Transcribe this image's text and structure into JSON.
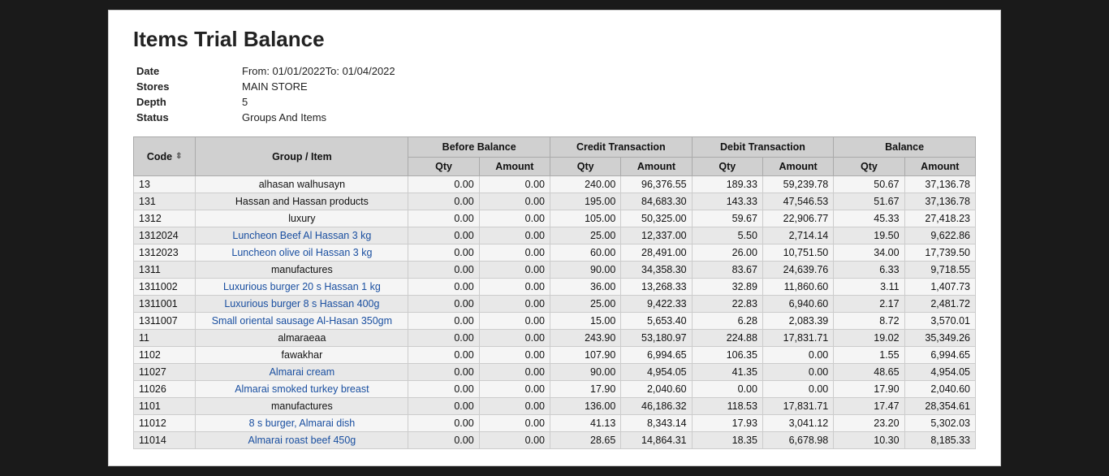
{
  "title": "Items Trial Balance",
  "meta": {
    "date_label": "Date",
    "date_value": "From: 01/01/2022To: 01/04/2022",
    "stores_label": "Stores",
    "stores_value": "MAIN STORE",
    "depth_label": "Depth",
    "depth_value": "5",
    "status_label": "Status",
    "status_value": "Groups And Items"
  },
  "table": {
    "headers": {
      "code": "Code",
      "group_item": "Group / Item",
      "before_balance": "Before Balance",
      "credit_transaction": "Credit Transaction",
      "debit_transaction": "Debit Transaction",
      "balance": "Balance"
    },
    "sub_headers": [
      "Qty",
      "Amount",
      "Qty",
      "Amount",
      "Qty",
      "Amount",
      "Qty",
      "Amount"
    ],
    "rows": [
      {
        "code": "13",
        "item": "alhasan walhusayn",
        "link": false,
        "bb_qty": "0.00",
        "bb_amt": "0.00",
        "ct_qty": "240.00",
        "ct_amt": "96,376.55",
        "dt_qty": "189.33",
        "dt_amt": "59,239.78",
        "bal_qty": "50.67",
        "bal_amt": "37,136.78"
      },
      {
        "code": "131",
        "item": "Hassan and Hassan products",
        "link": false,
        "bb_qty": "0.00",
        "bb_amt": "0.00",
        "ct_qty": "195.00",
        "ct_amt": "84,683.30",
        "dt_qty": "143.33",
        "dt_amt": "47,546.53",
        "bal_qty": "51.67",
        "bal_amt": "37,136.78"
      },
      {
        "code": "1312",
        "item": "luxury",
        "link": false,
        "bb_qty": "0.00",
        "bb_amt": "0.00",
        "ct_qty": "105.00",
        "ct_amt": "50,325.00",
        "dt_qty": "59.67",
        "dt_amt": "22,906.77",
        "bal_qty": "45.33",
        "bal_amt": "27,418.23"
      },
      {
        "code": "1312024",
        "item": "Luncheon Beef Al Hassan 3 kg",
        "link": true,
        "bb_qty": "0.00",
        "bb_amt": "0.00",
        "ct_qty": "25.00",
        "ct_amt": "12,337.00",
        "dt_qty": "5.50",
        "dt_amt": "2,714.14",
        "bal_qty": "19.50",
        "bal_amt": "9,622.86"
      },
      {
        "code": "1312023",
        "item": "Luncheon olive oil Hassan 3 kg",
        "link": true,
        "bb_qty": "0.00",
        "bb_amt": "0.00",
        "ct_qty": "60.00",
        "ct_amt": "28,491.00",
        "dt_qty": "26.00",
        "dt_amt": "10,751.50",
        "bal_qty": "34.00",
        "bal_amt": "17,739.50"
      },
      {
        "code": "1311",
        "item": "manufactures",
        "link": false,
        "bb_qty": "0.00",
        "bb_amt": "0.00",
        "ct_qty": "90.00",
        "ct_amt": "34,358.30",
        "dt_qty": "83.67",
        "dt_amt": "24,639.76",
        "bal_qty": "6.33",
        "bal_amt": "9,718.55"
      },
      {
        "code": "1311002",
        "item": "Luxurious burger 20 s Hassan 1 kg",
        "link": true,
        "bb_qty": "0.00",
        "bb_amt": "0.00",
        "ct_qty": "36.00",
        "ct_amt": "13,268.33",
        "dt_qty": "32.89",
        "dt_amt": "11,860.60",
        "bal_qty": "3.11",
        "bal_amt": "1,407.73"
      },
      {
        "code": "1311001",
        "item": "Luxurious burger 8 s Hassan 400g",
        "link": true,
        "bb_qty": "0.00",
        "bb_amt": "0.00",
        "ct_qty": "25.00",
        "ct_amt": "9,422.33",
        "dt_qty": "22.83",
        "dt_amt": "6,940.60",
        "bal_qty": "2.17",
        "bal_amt": "2,481.72"
      },
      {
        "code": "1311007",
        "item": "Small oriental sausage Al-Hasan 350gm",
        "link": true,
        "bb_qty": "0.00",
        "bb_amt": "0.00",
        "ct_qty": "15.00",
        "ct_amt": "5,653.40",
        "dt_qty": "6.28",
        "dt_amt": "2,083.39",
        "bal_qty": "8.72",
        "bal_amt": "3,570.01"
      },
      {
        "code": "11",
        "item": "almaraeaa",
        "link": false,
        "bb_qty": "0.00",
        "bb_amt": "0.00",
        "ct_qty": "243.90",
        "ct_amt": "53,180.97",
        "dt_qty": "224.88",
        "dt_amt": "17,831.71",
        "bal_qty": "19.02",
        "bal_amt": "35,349.26"
      },
      {
        "code": "1102",
        "item": "fawakhar",
        "link": false,
        "bb_qty": "0.00",
        "bb_amt": "0.00",
        "ct_qty": "107.90",
        "ct_amt": "6,994.65",
        "dt_qty": "106.35",
        "dt_amt": "0.00",
        "bal_qty": "1.55",
        "bal_amt": "6,994.65"
      },
      {
        "code": "11027",
        "item": "Almarai cream",
        "link": true,
        "bb_qty": "0.00",
        "bb_amt": "0.00",
        "ct_qty": "90.00",
        "ct_amt": "4,954.05",
        "dt_qty": "41.35",
        "dt_amt": "0.00",
        "bal_qty": "48.65",
        "bal_amt": "4,954.05"
      },
      {
        "code": "11026",
        "item": "Almarai smoked turkey breast",
        "link": true,
        "bb_qty": "0.00",
        "bb_amt": "0.00",
        "ct_qty": "17.90",
        "ct_amt": "2,040.60",
        "dt_qty": "0.00",
        "dt_amt": "0.00",
        "bal_qty": "17.90",
        "bal_amt": "2,040.60"
      },
      {
        "code": "1101",
        "item": "manufactures",
        "link": false,
        "bb_qty": "0.00",
        "bb_amt": "0.00",
        "ct_qty": "136.00",
        "ct_amt": "46,186.32",
        "dt_qty": "118.53",
        "dt_amt": "17,831.71",
        "bal_qty": "17.47",
        "bal_amt": "28,354.61"
      },
      {
        "code": "11012",
        "item": "8 s burger, Almarai dish",
        "link": true,
        "bb_qty": "0.00",
        "bb_amt": "0.00",
        "ct_qty": "41.13",
        "ct_amt": "8,343.14",
        "dt_qty": "17.93",
        "dt_amt": "3,041.12",
        "bal_qty": "23.20",
        "bal_amt": "5,302.03"
      },
      {
        "code": "11014",
        "item": "Almarai roast beef 450g",
        "link": true,
        "bb_qty": "0.00",
        "bb_amt": "0.00",
        "ct_qty": "28.65",
        "ct_amt": "14,864.31",
        "dt_qty": "18.35",
        "dt_amt": "6,678.98",
        "bal_qty": "10.30",
        "bal_amt": "8,185.33"
      }
    ]
  }
}
